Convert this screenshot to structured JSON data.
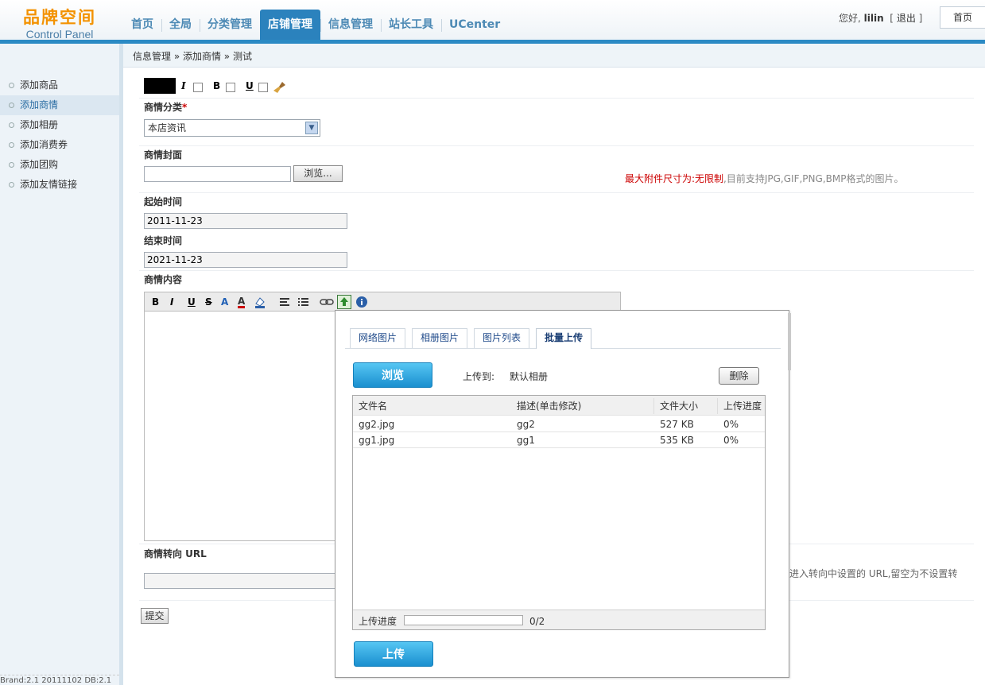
{
  "header": {
    "logo_cn": "品牌空间",
    "logo_en": "Control Panel",
    "nav": [
      "首页",
      "全局",
      "分类管理",
      "店铺管理",
      "信息管理",
      "站长工具",
      "UCenter"
    ],
    "nav_active_index": 3,
    "greeting": "您好,",
    "username": "lilin",
    "logout_open": "[",
    "logout": "退出",
    "logout_close": "]",
    "home_button": "首页"
  },
  "breadcrumb": "信息管理 » 添加商情 » 测试",
  "sidebar": {
    "items": [
      "添加商品",
      "添加商情",
      "添加相册",
      "添加消费券",
      "添加团购",
      "添加友情链接"
    ],
    "active_index": 1,
    "version": "Brand:2.1 20111102 DB:2.1"
  },
  "form": {
    "format_italic": "I",
    "format_bold": "B",
    "format_underline": "U",
    "category_label": "商情分类",
    "required_mark": "*",
    "category_value": "本店资讯",
    "cover_label": "商情封面",
    "browse_button": "浏览...",
    "size_note_prefix": "最大附件尺寸为:无限制",
    "size_note_suffix": ",目前支持JPG,GIF,PNG,BMP格式的图片。",
    "start_label": "起始时间",
    "start_value": "2011-11-23",
    "end_label": "结束时间",
    "end_value": "2021-11-23",
    "content_label": "商情内容",
    "url_label": "商情转向 URL",
    "url_note": "进入转向中设置的 URL,留空为不设置转",
    "submit": "提交"
  },
  "editor_toolbar": {
    "bold": "B",
    "italic": "I",
    "underline": "U",
    "strike": "S",
    "font_size": "A",
    "font_color": "A"
  },
  "dialog": {
    "tabs": [
      "网络图片",
      "相册图片",
      "图片列表",
      "批量上传"
    ],
    "active_tab_index": 3,
    "browse_button": "浏览",
    "upload_to_label": "上传到:",
    "album": "默认相册",
    "delete_button": "删除",
    "columns": [
      "文件名",
      "描述(单击修改)",
      "文件大小",
      "上传进度"
    ],
    "rows": [
      {
        "name": "gg2.jpg",
        "desc": "gg2",
        "size": "527 KB",
        "progress": "0%"
      },
      {
        "name": "gg1.jpg",
        "desc": "gg1",
        "size": "535 KB",
        "progress": "0%"
      }
    ],
    "progress_label": "上传进度",
    "progress_fraction": 0,
    "progress_count": "0/2",
    "upload_button": "上传"
  }
}
